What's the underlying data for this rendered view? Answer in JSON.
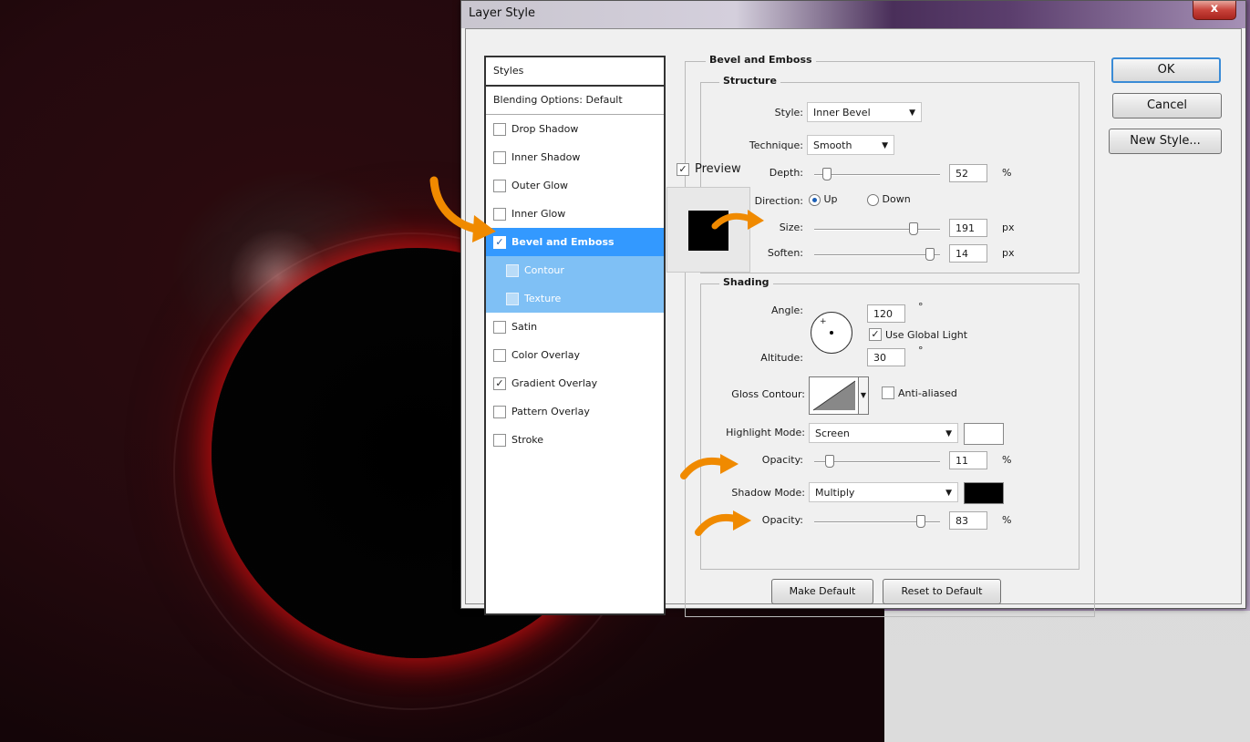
{
  "dialog": {
    "title": "Layer Style",
    "close_label": "x"
  },
  "styles_panel": {
    "header": "Styles",
    "blending_options": "Blending Options: Default",
    "items": [
      {
        "label": "Drop Shadow",
        "checked": false
      },
      {
        "label": "Inner Shadow",
        "checked": false
      },
      {
        "label": "Outer Glow",
        "checked": false
      },
      {
        "label": "Inner Glow",
        "checked": false
      },
      {
        "label": "Bevel and Emboss",
        "checked": true,
        "selected": true
      },
      {
        "label": "Contour",
        "checked": false,
        "sub": true
      },
      {
        "label": "Texture",
        "checked": false,
        "sub": true
      },
      {
        "label": "Satin",
        "checked": false
      },
      {
        "label": "Color Overlay",
        "checked": false
      },
      {
        "label": "Gradient Overlay",
        "checked": true
      },
      {
        "label": "Pattern Overlay",
        "checked": false
      },
      {
        "label": "Stroke",
        "checked": false
      }
    ]
  },
  "buttons": {
    "ok": "OK",
    "cancel": "Cancel",
    "new_style": "New Style...",
    "preview": "Preview",
    "make_default": "Make Default",
    "reset_default": "Reset to Default"
  },
  "bevel": {
    "title": "Bevel and Emboss",
    "structure": {
      "title": "Structure",
      "style_label": "Style:",
      "style_value": "Inner Bevel",
      "technique_label": "Technique:",
      "technique_value": "Smooth",
      "depth_label": "Depth:",
      "depth_value": "52",
      "depth_unit": "%",
      "direction_label": "Direction:",
      "direction_up": "Up",
      "direction_down": "Down",
      "size_label": "Size:",
      "size_value": "191",
      "size_unit": "px",
      "soften_label": "Soften:",
      "soften_value": "14",
      "soften_unit": "px"
    },
    "shading": {
      "title": "Shading",
      "angle_label": "Angle:",
      "angle_value": "120",
      "degree": "°",
      "global_light": "Use Global Light",
      "altitude_label": "Altitude:",
      "altitude_value": "30",
      "gloss_label": "Gloss Contour:",
      "anti_aliased": "Anti-aliased",
      "highlight_mode_label": "Highlight Mode:",
      "highlight_mode_value": "Screen",
      "highlight_opacity_label": "Opacity:",
      "highlight_opacity_value": "11",
      "shadow_mode_label": "Shadow Mode:",
      "shadow_mode_value": "Multiply",
      "shadow_opacity_label": "Opacity:",
      "shadow_opacity_value": "83",
      "percent": "%"
    }
  },
  "colors": {
    "highlight": "#ffffff",
    "shadow": "#000000",
    "selection": "#3399ff",
    "arrow": "#f08a00"
  }
}
